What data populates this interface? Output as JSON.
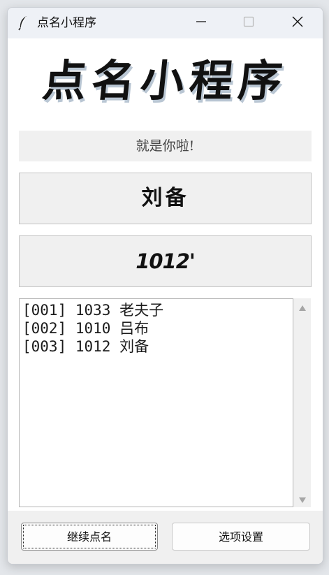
{
  "window": {
    "title": "点名小程序"
  },
  "icons": {
    "app": "feather-icon",
    "minimize": "minimize-icon",
    "maximize": "maximize-icon",
    "close": "close-icon",
    "scroll_up": "triangle-up-icon",
    "scroll_down": "triangle-down-icon"
  },
  "main": {
    "heading": "点名小程序",
    "message": "就是你啦!",
    "current_name": "刘备",
    "current_number": "1012'"
  },
  "history": {
    "items": [
      "[001] 1033 老夫子",
      "[002] 1010 吕布",
      "[003] 1012 刘备"
    ]
  },
  "buttons": {
    "continue_label": "继续点名",
    "settings_label": "选项设置"
  },
  "colors": {
    "background": "#f0f0f0",
    "titlebar": "#eef1f6",
    "heading_shadow": "#b9c6d3"
  }
}
